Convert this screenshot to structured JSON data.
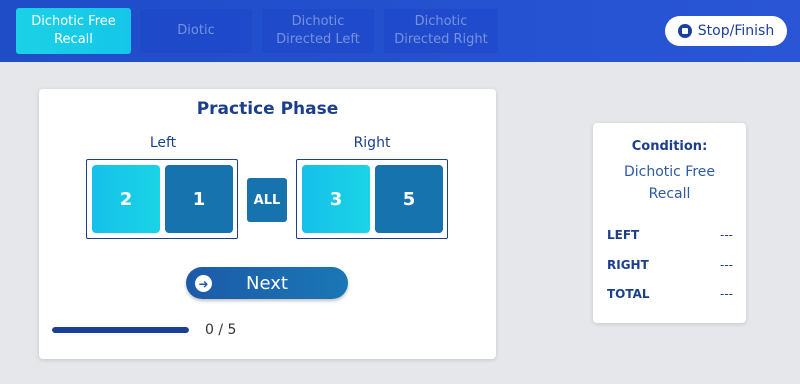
{
  "tabs": [
    {
      "label": "Dichotic Free Recall",
      "active": true
    },
    {
      "label": "Diotic",
      "active": false
    },
    {
      "label": "Dichotic Directed Left",
      "active": false
    },
    {
      "label": "Dichotic Directed Right",
      "active": false
    }
  ],
  "stop_button": {
    "label": "Stop/Finish",
    "icon": "stop-circle-icon"
  },
  "practice": {
    "title": "Practice Phase",
    "left_label": "Left",
    "right_label": "Right",
    "left_digits": [
      "2",
      "1"
    ],
    "right_digits": [
      "3",
      "5"
    ],
    "all_label": "ALL",
    "next_label": "Next",
    "next_icon": "arrow-right-circle-icon",
    "progress_text": "0 / 5",
    "progress_fraction": 1.0
  },
  "info": {
    "heading": "Condition:",
    "condition": "Dichotic Free Recall",
    "stats": [
      {
        "label": "LEFT",
        "value": "---"
      },
      {
        "label": "RIGHT",
        "value": "---"
      },
      {
        "label": "TOTAL",
        "value": "---"
      }
    ]
  },
  "colors": {
    "header": "#2452d0",
    "accent": "#1bd1e6",
    "dark_tile": "#1673ae",
    "text": "#1b3f8c"
  }
}
